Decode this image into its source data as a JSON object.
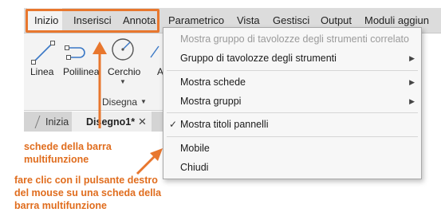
{
  "ribbon": {
    "tabs": [
      "Inizio",
      "Inserisci",
      "Annota",
      "Parametrico",
      "Vista",
      "Gestisci",
      "Output",
      "Moduli aggiun"
    ]
  },
  "panel": {
    "tools": [
      "Linea",
      "Polilinea",
      "Cerchio",
      "A"
    ],
    "title": "Disegna"
  },
  "file_tabs": {
    "start": "Inizia",
    "drawing": "Disegno1*"
  },
  "context_menu": {
    "items": [
      "Mostra gruppo di tavolozze degli strumenti correlato",
      "Gruppo di tavolozze degli strumenti",
      "Mostra schede",
      "Mostra gruppi",
      "Mostra titoli pannelli",
      "Mobile",
      "Chiudi"
    ]
  },
  "callouts": {
    "ribbon_tabs": "schede della barra multifunzione",
    "right_click": "fare clic con il pulsante destro del mouse su una scheda della barra multifunzione"
  },
  "colors": {
    "accent": "#e8772e",
    "callout_text": "#e06d1e"
  }
}
